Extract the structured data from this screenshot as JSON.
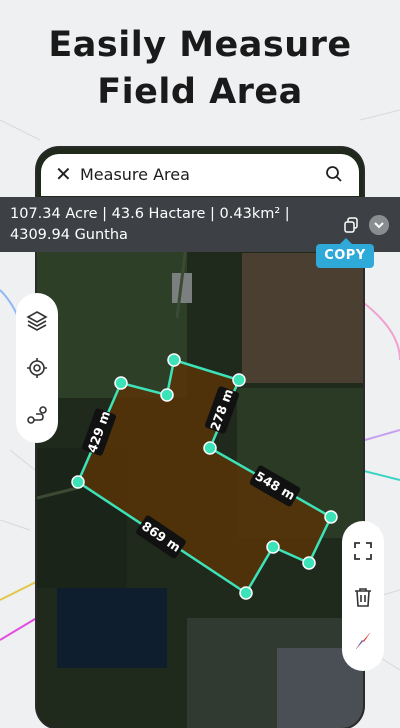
{
  "headline": {
    "line1": "Easily Measure",
    "line2": "Field Area"
  },
  "search": {
    "title": "Measure Area",
    "close_icon": "close-icon",
    "search_icon": "search-icon"
  },
  "measurement": {
    "line1": "107.34 Acre | 43.6 Hactare | 0.43km² |",
    "line2": "4309.94 Guntha",
    "copy_label": "COPY"
  },
  "left_tools": [
    "layers-icon",
    "target-icon",
    "route-icon"
  ],
  "right_tools": [
    "fullscreen-icon",
    "trash-icon",
    "compass-icon"
  ],
  "segments": {
    "s1": "429 m",
    "s2": "278 m",
    "s3": "548 m",
    "s4": "869 m"
  },
  "colors": {
    "polygon_stroke": "#3de3b8",
    "polygon_fill": "#5a3306",
    "copy_badge": "#2ea9d8",
    "compass_red": "#e53935",
    "compass_blue": "#1e63c9"
  }
}
